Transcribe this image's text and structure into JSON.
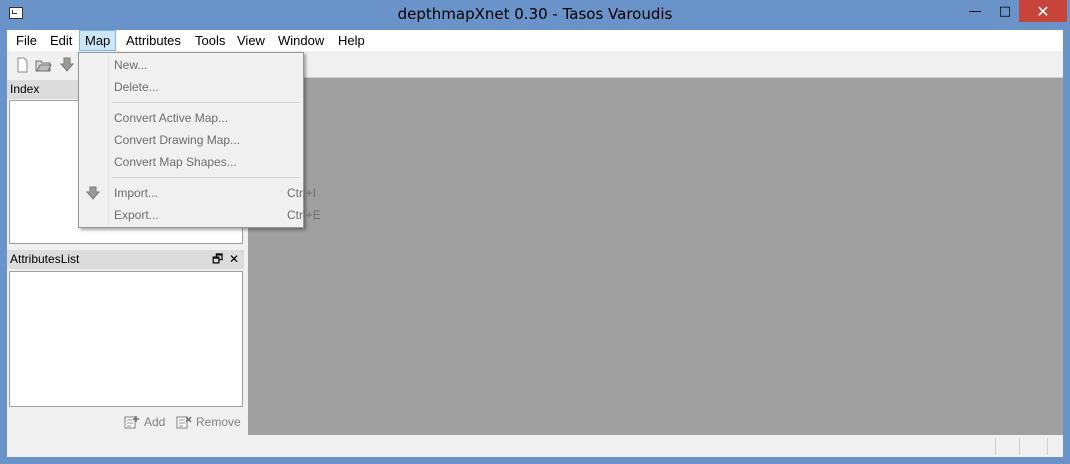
{
  "window": {
    "title": "depthmapXnet 0.30 - Tasos Varoudis",
    "minimize_glyph": "—",
    "maximize_glyph": "□",
    "close_glyph": "✕"
  },
  "menubar": {
    "items": [
      "File",
      "Edit",
      "Map",
      "Attributes",
      "Tools",
      "View",
      "Window",
      "Help"
    ]
  },
  "toolbar": {
    "icons": [
      "new-document-icon",
      "open-folder-icon",
      "import-arrow-icon"
    ]
  },
  "docks": {
    "index": {
      "title": "Index"
    },
    "attributes": {
      "title": "AttributesList",
      "float_glyph": "🗗",
      "close_glyph": "✕"
    }
  },
  "attributes_buttons": {
    "add": "Add",
    "remove": "Remove"
  },
  "map_menu": {
    "items": [
      {
        "label": "New...",
        "shortcut": ""
      },
      {
        "label": "Delete...",
        "shortcut": ""
      },
      {
        "label": "Convert Active Map...",
        "shortcut": ""
      },
      {
        "label": "Convert Drawing Map...",
        "shortcut": ""
      },
      {
        "label": "Convert Map Shapes...",
        "shortcut": ""
      },
      {
        "label": "Import...",
        "shortcut": "Ctrl+I"
      },
      {
        "label": "Export...",
        "shortcut": "Ctrl+E"
      }
    ]
  },
  "colors": {
    "window_frame": "#6a93c9",
    "mdi_background": "#a0a0a0",
    "close_button": "#c7443a",
    "menu_highlight": "#cde6f7"
  }
}
